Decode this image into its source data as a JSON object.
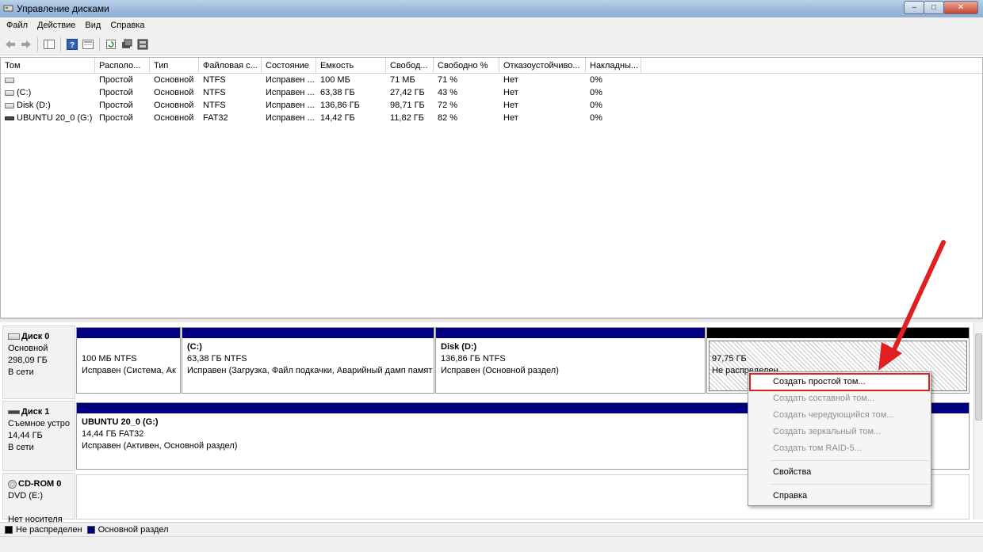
{
  "window": {
    "title": "Управление дисками"
  },
  "menu": [
    "Файл",
    "Действие",
    "Вид",
    "Справка"
  ],
  "toolbar_icons": [
    "back-icon",
    "forward-icon",
    "show-hide-tree-icon",
    "help-icon",
    "properties-icon",
    "refresh-icon",
    "rescan-disks-icon",
    "settings-icon"
  ],
  "list": {
    "columns": [
      "Том",
      "Располо...",
      "Тип",
      "Файловая с...",
      "Состояние",
      "Емкость",
      "Свобод...",
      "Свободно %",
      "Отказоустойчиво...",
      "Накладны..."
    ],
    "rows": [
      {
        "name": "",
        "layout": "Простой",
        "type": "Основной",
        "fs": "NTFS",
        "status": "Исправен ...",
        "capacity": "100 МБ",
        "free": "71 МБ",
        "free_pct": "71 %",
        "fault": "Нет",
        "overhead": "0%"
      },
      {
        "name": "(C:)",
        "layout": "Простой",
        "type": "Основной",
        "fs": "NTFS",
        "status": "Исправен ...",
        "capacity": "63,38 ГБ",
        "free": "27,42 ГБ",
        "free_pct": "43 %",
        "fault": "Нет",
        "overhead": "0%"
      },
      {
        "name": "Disk (D:)",
        "layout": "Простой",
        "type": "Основной",
        "fs": "NTFS",
        "status": "Исправен ...",
        "capacity": "136,86 ГБ",
        "free": "98,71 ГБ",
        "free_pct": "72 %",
        "fault": "Нет",
        "overhead": "0%"
      },
      {
        "name": "UBUNTU 20_0 (G:)",
        "layout": "Простой",
        "type": "Основной",
        "fs": "FAT32",
        "status": "Исправен ...",
        "capacity": "14,42 ГБ",
        "free": "11,82 ГБ",
        "free_pct": "82 %",
        "fault": "Нет",
        "overhead": "0%"
      }
    ]
  },
  "disks": {
    "disk0": {
      "name": "Диск 0",
      "type": "Основной",
      "size": "298,09 ГБ",
      "state": "В сети",
      "p1": {
        "title": "",
        "line1": "100 МБ NTFS",
        "line2": "Исправен (Система, Ак"
      },
      "p2": {
        "title": "(C:)",
        "line1": "63,38 ГБ NTFS",
        "line2": "Исправен (Загрузка, Файл подкачки, Аварийный дамп памят"
      },
      "p3": {
        "title": "Disk  (D:)",
        "line1": "136,86 ГБ NTFS",
        "line2": "Исправен (Основной раздел)"
      },
      "p4": {
        "line1": "97,75 ГБ",
        "line2": "Не распределен"
      }
    },
    "disk1": {
      "name": "Диск 1",
      "type": "Съемное устро",
      "size": "14,44 ГБ",
      "state": "В сети",
      "p1": {
        "title": "UBUNTU 20_0  (G:)",
        "line1": "14,44 ГБ FAT32",
        "line2": "Исправен (Активен, Основной раздел)"
      }
    },
    "cdrom0": {
      "name": "CD-ROM 0",
      "type": "DVD (E:)",
      "state": "Нет носителя"
    }
  },
  "legend": {
    "unallocated": "Не распределен",
    "primary": "Основной раздел"
  },
  "context_menu": {
    "items": [
      {
        "label": "Создать простой том...",
        "enabled": true
      },
      {
        "label": "Создать составной том...",
        "enabled": false
      },
      {
        "label": "Создать чередующийся том...",
        "enabled": false
      },
      {
        "label": "Создать зеркальный том...",
        "enabled": false
      },
      {
        "label": "Создать том RAID-5...",
        "enabled": false
      }
    ],
    "properties": "Свойства",
    "help": "Справка"
  },
  "colors": {
    "primary_partition": "#000080",
    "unallocated": "#000000",
    "annotation": "#e02020"
  }
}
